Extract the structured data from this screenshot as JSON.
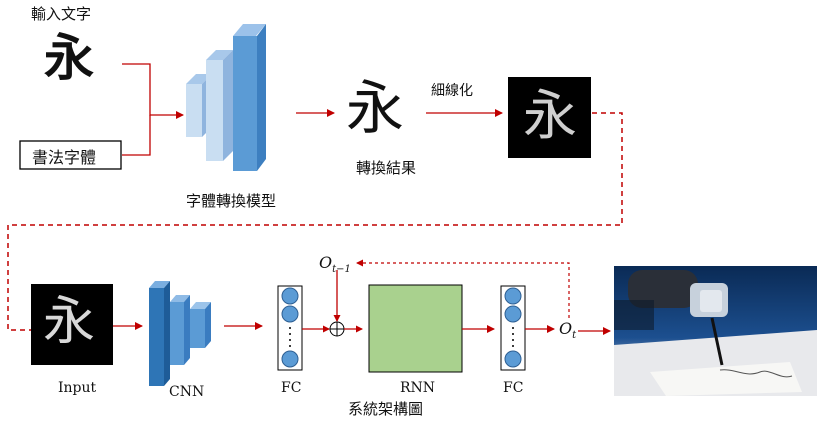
{
  "top": {
    "input_label": "輸入文字",
    "input_char": "永",
    "calligraphy_box": "書法字體",
    "model_caption": "字體轉換模型",
    "result_char": "永",
    "result_caption": "轉換結果",
    "thinning_label": "細線化",
    "thinned_char": "永"
  },
  "bottom": {
    "input_char": "永",
    "input_caption": "Input",
    "cnn_caption": "CNN",
    "fc1_caption": "FC",
    "rnn_caption": "RNN",
    "fc2_caption": "FC",
    "system_caption": "系統架構圖",
    "feedback_label": "O",
    "feedback_sub": "t−1",
    "output_label": "O",
    "output_sub": "t"
  },
  "colors": {
    "arrow": "#c00000",
    "model_blue": "#5b9bd5",
    "model_light": "#bdd7ee",
    "cnn_blue": "#2e75b6",
    "fc_node": "#5b9bd5",
    "rnn_green": "#a9d18e",
    "black_panel": "#000000"
  },
  "icons": {
    "sum_node": "circle-plus-icon",
    "robot_photo": "robot-arm-writing-photo"
  }
}
